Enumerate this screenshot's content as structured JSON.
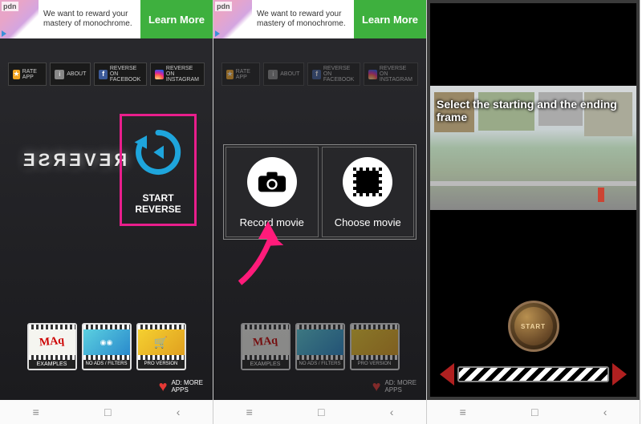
{
  "ad": {
    "brand": "pdn",
    "text": "We want to reward your mastery of monochrome.",
    "cta": "Learn More"
  },
  "chips": {
    "rate": "RATE APP",
    "about": "ABOUT",
    "fb": "REVERSE ON\nFACEBOOK",
    "ig": "REVERSE ON\nINSTAGRAM"
  },
  "screen1": {
    "logo": "REVERSE",
    "start": "START\nREVERSE"
  },
  "thumbnails": {
    "examples_label": "EXAMPLES",
    "examples_badge": "MAq",
    "filters_label": "NO ADS / FILTERS",
    "pro_label": "PRO VERSION"
  },
  "bottom": {
    "more_apps": "AD: MORE\nAPPS"
  },
  "dialog": {
    "record": "Record movie",
    "choose": "Choose movie"
  },
  "screen3": {
    "overlay": "Select the starting and the ending frame",
    "start_button": "START"
  },
  "nav": {
    "recent": "≡",
    "home": "□",
    "back": "‹"
  }
}
